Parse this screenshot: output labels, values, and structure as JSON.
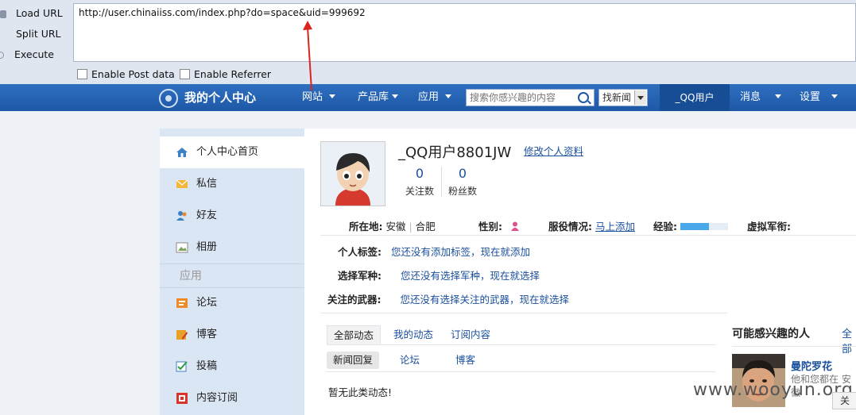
{
  "hackbar": {
    "load_label": "Load URL",
    "split_label": "Split URL",
    "execute_label": "Execute",
    "url_value": "http://user.chinaiiss.com/index.php?do=space&uid=999692",
    "post_label": "Enable Post data",
    "referrer_label": "Enable Referrer"
  },
  "nav": {
    "logo": "我的个人中心",
    "items": [
      {
        "label": "网站"
      },
      {
        "label": "产品库"
      },
      {
        "label": "应用"
      }
    ],
    "search_placeholder": "搜索你感兴趣的内容",
    "select_value": "找新闻",
    "user": "_QQ用户",
    "messages": "消息",
    "settings": "设置"
  },
  "sidebar": {
    "items": [
      {
        "label": "个人中心首页"
      },
      {
        "label": "私信"
      },
      {
        "label": "好友"
      },
      {
        "label": "相册"
      }
    ],
    "group": "应用",
    "apps": [
      {
        "label": "论坛"
      },
      {
        "label": "博客"
      },
      {
        "label": "投稿"
      },
      {
        "label": "内容订阅"
      }
    ]
  },
  "profile": {
    "name": "_QQ用户8801JW",
    "edit": "修改个人资料",
    "follow_count": "0",
    "follow_label": "关注数",
    "fans_count": "0",
    "fans_label": "粉丝数",
    "loc_label": "所在地:",
    "loc_province": "安徽",
    "loc_city": "合肥",
    "gender_label": "性别:",
    "service_label": "服役情况:",
    "service_link": "马上添加",
    "exp_label": "经验:",
    "exp_fraction": 0.6,
    "rank_label": "虚拟军衔:",
    "tag_label": "个人标签:",
    "tag_value": "您还没有添加标签，现在就添加",
    "branch_label": "选择军种:",
    "branch_value": "您还没有选择军种，现在就选择",
    "weapon_label": "关注的武器:",
    "weapon_value": "您还没有选择关注的武器，现在就选择"
  },
  "feed": {
    "tabs": [
      {
        "label": "全部动态"
      },
      {
        "label": "我的动态"
      },
      {
        "label": "订阅内容"
      }
    ],
    "subtabs": [
      {
        "label": "新闻回复"
      },
      {
        "label": "论坛"
      },
      {
        "label": "博客"
      }
    ],
    "empty": "暂无此类动态!"
  },
  "suggest": {
    "title": "可能感兴趣的人",
    "all": "全部",
    "name": "曼陀罗花",
    "desc": "他和您都在 安徽",
    "add": "关"
  },
  "watermark": "www.wooyun.org",
  "colors": {
    "nav": "#1d58a6",
    "sidebar": "#dbe6f4",
    "link": "#1a4f9c",
    "arrow": "#d9251d"
  }
}
